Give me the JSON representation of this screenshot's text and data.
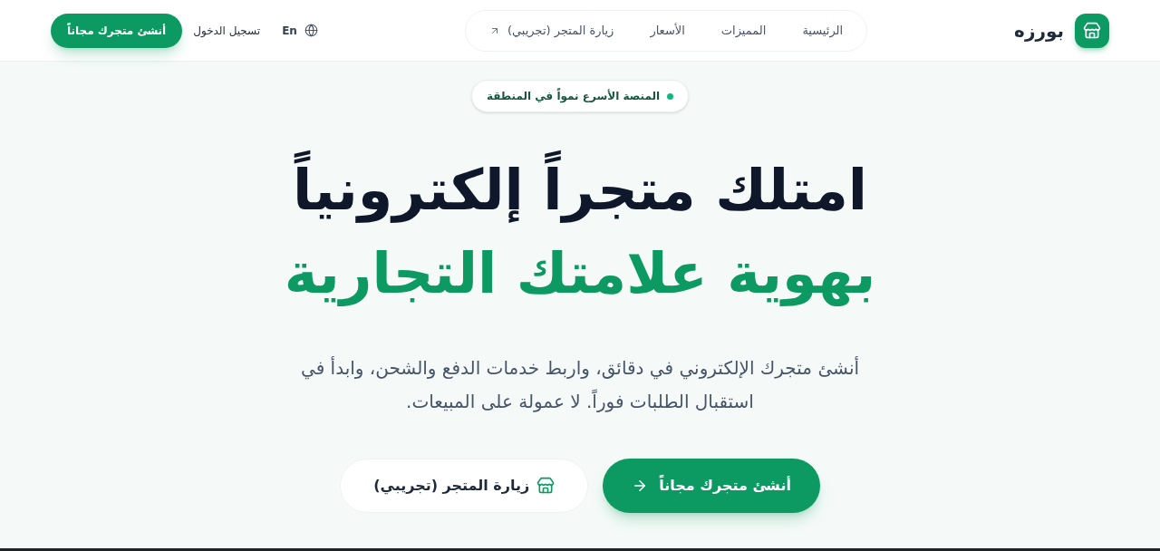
{
  "header": {
    "logo_text": "بورزه",
    "nav": [
      {
        "label": "الرئيسية",
        "kind": "link"
      },
      {
        "label": "المميزات",
        "kind": "link"
      },
      {
        "label": "الأسعار",
        "kind": "link"
      },
      {
        "label": "زيارة المتجر (تجريبي)",
        "kind": "external"
      }
    ],
    "language": "En",
    "login": "تسجيل الدخول",
    "cta": "أنشئ متجرك مجاناً"
  },
  "hero": {
    "badge": "المنصة الأسرع نمواً في المنطقة",
    "title_line_1": "امتلك متجراً إلكترونياً",
    "title_line_2": "بهوية علامتك التجارية",
    "description": "أنشئ متجرك الإلكتروني في دقائق، واربط خدمات الدفع والشحن، وابدأ في استقبال الطلبات فوراً. لا عمولة على المبيعات.",
    "buttons": [
      {
        "label": "أنشئ متجرك مجاناً",
        "kind": "primary"
      },
      {
        "label": "زيارة المتجر (تجريبي)",
        "kind": "secondary"
      }
    ]
  }
}
